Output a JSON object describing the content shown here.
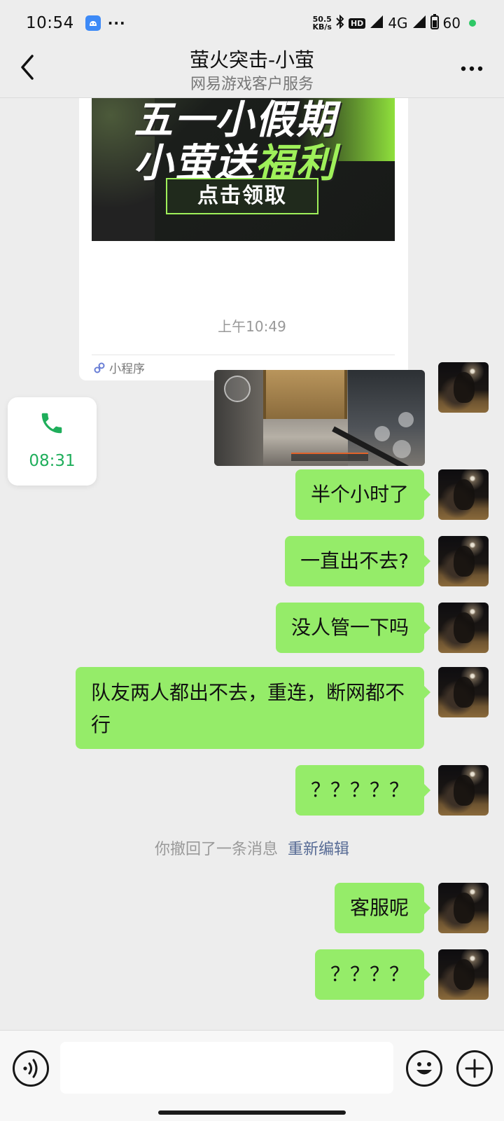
{
  "status_bar": {
    "time": "10:54",
    "more": "···",
    "speed_value": "50.5",
    "speed_unit": "KB/s",
    "hd": "HD",
    "network": "4G",
    "battery": "60"
  },
  "header": {
    "title": "萤火突击-小萤",
    "subtitle": "网易游戏客户服务"
  },
  "mini_program": {
    "banner_line1": "五一小假期",
    "banner_line2_a": "小萤送",
    "banner_line2_b": "福利",
    "banner_button": "点击领取",
    "label": "小程序"
  },
  "timestamp": "上午10:49",
  "call": {
    "duration": "08:31"
  },
  "messages": [
    {
      "text": "半个小时了"
    },
    {
      "text": "一直出不去?"
    },
    {
      "text": "没人管一下吗"
    },
    {
      "text": "队友两人都出不去，重连，断网都不行"
    },
    {
      "text": "？？？？？"
    },
    {
      "text": "客服呢"
    },
    {
      "text": "？？？？"
    }
  ],
  "recall_notice": {
    "text": "你撤回了一条消息",
    "action": "重新编辑"
  },
  "colors": {
    "bubble": "#95ec69",
    "background": "#ededed",
    "call_green": "#1fae5b",
    "link": "#576b95"
  },
  "icons": {
    "back": "chevron-left-icon",
    "more": "more-dots-icon",
    "voice": "voice-icon",
    "emoji": "emoji-icon",
    "plus": "plus-icon",
    "phone": "phone-icon",
    "mini_program": "mini-program-icon"
  }
}
